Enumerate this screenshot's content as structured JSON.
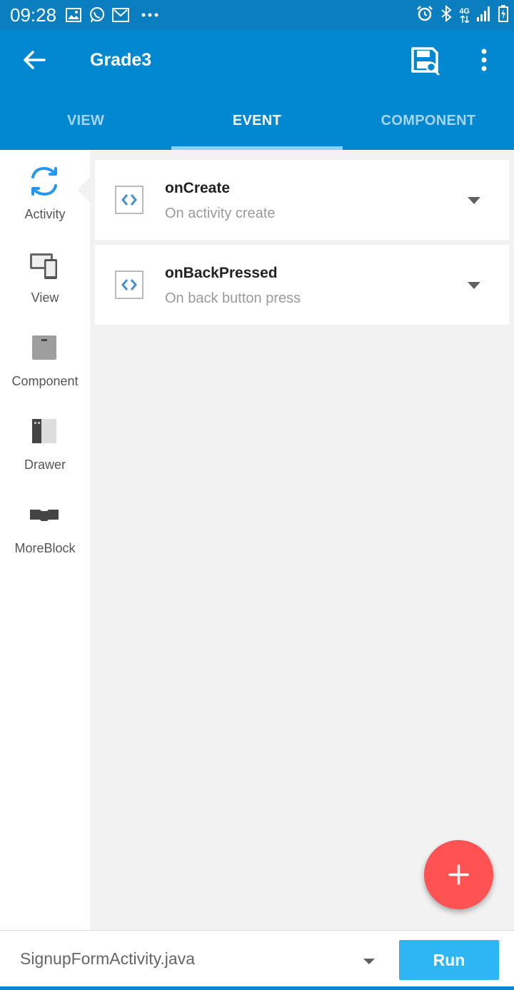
{
  "status_bar": {
    "time": "09:28",
    "network": "4G",
    "left_icons": [
      "gallery-icon",
      "whatsapp-icon",
      "gmail-icon",
      "more-notifications-icon"
    ],
    "right_icons": [
      "alarm-icon",
      "bluetooth-icon",
      "network-4g-icon",
      "signal-icon",
      "battery-icon"
    ]
  },
  "app_bar": {
    "title": "Grade3",
    "icons": [
      "back-arrow-icon",
      "save-icon",
      "more-vert-icon"
    ]
  },
  "tabs": [
    {
      "label": "VIEW",
      "active": false
    },
    {
      "label": "EVENT",
      "active": true
    },
    {
      "label": "COMPONENT",
      "active": false
    }
  ],
  "sidebar": {
    "items": [
      {
        "label": "Activity",
        "icon": "activity-refresh-icon",
        "selected": true
      },
      {
        "label": "View",
        "icon": "devices-icon",
        "selected": false
      },
      {
        "label": "Component",
        "icon": "component-icon",
        "selected": false
      },
      {
        "label": "Drawer",
        "icon": "drawer-icon",
        "selected": false
      },
      {
        "label": "MoreBlock",
        "icon": "moreblock-icon",
        "selected": false
      }
    ]
  },
  "events": [
    {
      "name": "onCreate",
      "description": "On activity create",
      "icon": "code-brackets-icon"
    },
    {
      "name": "onBackPressed",
      "description": "On back button press",
      "icon": "code-brackets-icon"
    }
  ],
  "fab": {
    "icon": "plus-icon"
  },
  "bottom_bar": {
    "file": "SignupFormActivity.java",
    "run_label": "Run"
  },
  "colors": {
    "status_bar": "#0b7ec0",
    "primary": "#0288d1",
    "tab_indicator": "#7fd4ff",
    "fab": "#ff5252",
    "run_button": "#2eb6f4",
    "activity_icon": "#2196f3"
  }
}
